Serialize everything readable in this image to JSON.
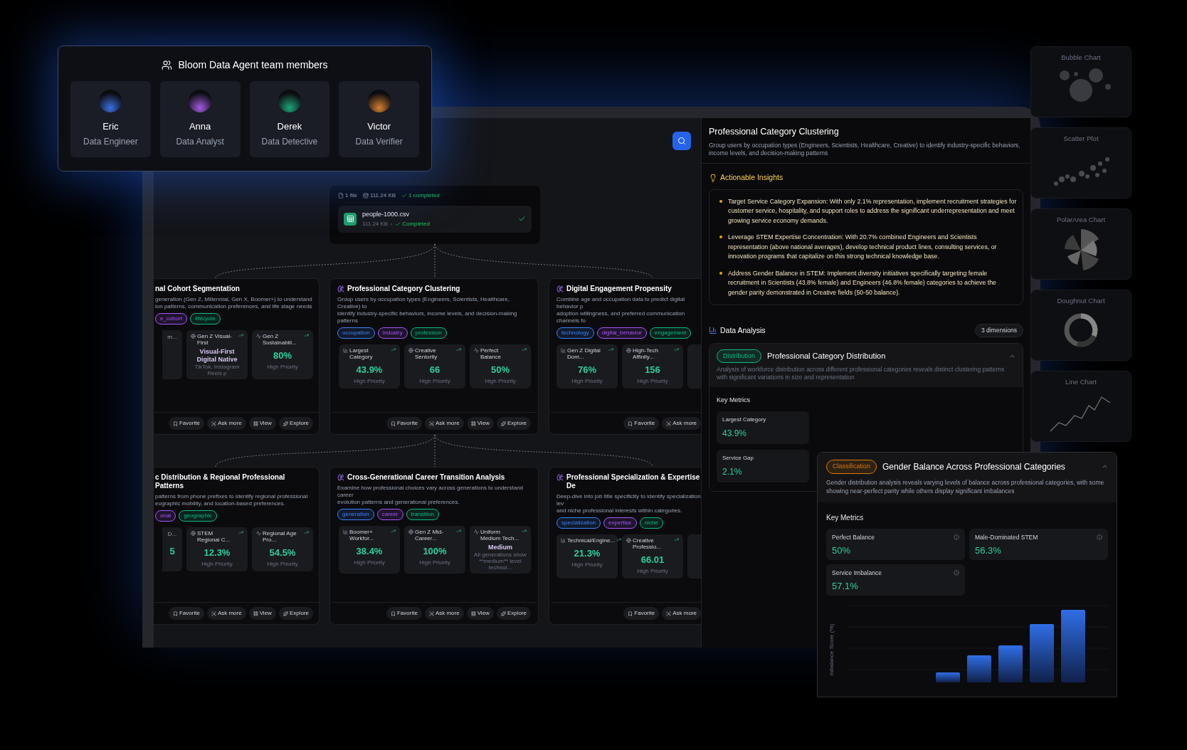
{
  "team_panel": {
    "title": "Bloom Data Agent team members",
    "members": [
      {
        "name": "Eric",
        "role": "Data Engineer",
        "color": "#3b6fe0"
      },
      {
        "name": "Anna",
        "role": "Data Analyst",
        "color": "#a35ce0"
      },
      {
        "name": "Derek",
        "role": "Data Detective",
        "color": "#1fa37a"
      },
      {
        "name": "Victor",
        "role": "Data Verifier",
        "color": "#d4802f"
      }
    ]
  },
  "canvas": {
    "file_node": {
      "file_count": "1 file",
      "total_size": "111.24 KB",
      "status": "1 completed",
      "file_name": "people-1000.csv",
      "file_size": "111.24 KB",
      "file_status": "Completed"
    },
    "cards": [
      {
        "kind": "cut_left",
        "title": "nal Cohort Segmentation",
        "description": [
          "generation (Gen Z, Millennial, Gen X, Boomer+) to understand",
          "ion patterns, communication preferences, and life stage needs"
        ],
        "tags": [
          {
            "label": "e_cohort",
            "color": "#a855f7"
          },
          {
            "label": "lifecycle",
            "color": "#10b981"
          }
        ],
        "metrics": [
          {
            "kind": "partial",
            "label": "m..."
          },
          {
            "kind": "text",
            "label": "Gen Z Visual-First",
            "value": "Visual-First Digital Native",
            "note": "TikTok, Instagram Reels p"
          },
          {
            "kind": "stat",
            "label": "Gen Z Sustainabili...",
            "value": "80%",
            "note": "High Priority"
          }
        ],
        "actions": [
          "Favorite",
          "Ask more",
          "View",
          "Explore"
        ]
      },
      {
        "kind": "full",
        "title": "Professional Category Clustering",
        "description": [
          "Group users by occupation types (Engineers, Scientists, Healthcare, Creative) to",
          "identify industry-specific behaviors, income levels, and decision-making patterns"
        ],
        "tags": [
          {
            "label": "occupation",
            "color": "#3b82f6"
          },
          {
            "label": "industry",
            "color": "#a855f7"
          },
          {
            "label": "profession",
            "color": "#10b981"
          }
        ],
        "metrics": [
          {
            "kind": "stat",
            "label": "Largest Category",
            "value": "43.9%",
            "note": "High Priority"
          },
          {
            "kind": "stat",
            "label": "Creative Seniority",
            "value": "66",
            "note": "High Priority"
          },
          {
            "kind": "stat",
            "label": "Perfect Balance",
            "value": "50%",
            "note": "High Priority"
          }
        ],
        "actions": [
          "Favorite",
          "Ask more",
          "View",
          "Explore"
        ]
      },
      {
        "kind": "cut_right",
        "title": "Digital Engagement Propensity",
        "description": [
          "Combine age and occupation data to predict digital behavior p",
          "adoption willingness, and preferred communication channels fo"
        ],
        "tags": [
          {
            "label": "technology",
            "color": "#3b82f6"
          },
          {
            "label": "digital_behavior",
            "color": "#a855f7"
          },
          {
            "label": "engagement",
            "color": "#10b981"
          }
        ],
        "metrics": [
          {
            "kind": "stat",
            "label": "Gen Z Digital Dom...",
            "value": "76%",
            "note": "High Priority"
          },
          {
            "kind": "stat",
            "label": "High-Tech Affinity...",
            "value": "156",
            "note": "High Priority"
          },
          {
            "kind": "partial"
          }
        ],
        "actions": [
          "Favorite",
          "Ask more"
        ]
      },
      {
        "kind": "cut_left",
        "title": "c Distribution & Regional Professional Patterns",
        "description": [
          "patterns from phone prefixes to identify regional professional",
          "eographic mobility, and location-based preferences."
        ],
        "tags": [
          {
            "label": "onal",
            "color": "#a855f7"
          },
          {
            "label": "geographic",
            "color": "#10b981"
          }
        ],
        "metrics": [
          {
            "kind": "partial",
            "label": "D...",
            "value": "5"
          },
          {
            "kind": "stat",
            "label": "STEM Regional C...",
            "value": "12.3%",
            "note": "High Priority"
          },
          {
            "kind": "stat",
            "label": "Regional Age Pro...",
            "value": "54.5%",
            "note": "High Priority"
          }
        ],
        "actions": [
          "Favorite",
          "Ask more",
          "View",
          "Explore"
        ]
      },
      {
        "kind": "full",
        "title": "Cross-Generational Career Transition Analysis",
        "description": [
          "Examine how professional choices vary across generations to understand career",
          "evolution patterns and generational preferences."
        ],
        "tags": [
          {
            "label": "generation",
            "color": "#3b82f6"
          },
          {
            "label": "career",
            "color": "#a855f7"
          },
          {
            "label": "transition",
            "color": "#10b981"
          }
        ],
        "metrics": [
          {
            "kind": "stat",
            "label": "Boomer+ Workfor...",
            "value": "38.4%",
            "note": "High Priority"
          },
          {
            "kind": "stat",
            "label": "Gen Z Mid-Career...",
            "value": "100%",
            "note": "High Priority"
          },
          {
            "kind": "text",
            "label": "Uniform Medium Tech...",
            "value": "Medium",
            "note": "All generations show **medium** level technol..."
          }
        ],
        "actions": [
          "Favorite",
          "Ask more",
          "View",
          "Explore"
        ]
      },
      {
        "kind": "cut_right",
        "title": "Professional Specialization & Expertise De",
        "description": [
          "Deep-dive into job title specificity to identify specialization lev",
          "and niche professional interests within categories."
        ],
        "tags": [
          {
            "label": "specialization",
            "color": "#3b82f6"
          },
          {
            "label": "expertise",
            "color": "#a855f7"
          },
          {
            "label": "niche",
            "color": "#10b981"
          }
        ],
        "metrics": [
          {
            "kind": "stat",
            "label": "Technical/Engine...",
            "value": "21.3%",
            "note": "High Priority"
          },
          {
            "kind": "stat",
            "label": "Creative Professio...",
            "value": "66.01",
            "note": "High Priority"
          },
          {
            "kind": "partial"
          }
        ],
        "actions": [
          "Favorite",
          "Ask more"
        ]
      }
    ]
  },
  "detail_panel": {
    "title": "Professional Category Clustering",
    "description": "Group users by occupation types (Engineers, Scientists, Healthcare, Creative) to identify industry-specific behaviors, income levels, and decision-making patterns",
    "insights": {
      "heading": "Actionable Insights",
      "items": [
        "Target Service Category Expansion: With only 2.1% representation, implement recruitment strategies for customer service, hospitality, and support roles to address the significant underrepresentation and meet growing service economy demands.",
        "Leverage STEM Expertise Concentration: With 20.7% combined Engineers and Scientists representation (above national averages), develop technical product lines, consulting services, or innovation programs that capitalize on this strong technical knowledge base.",
        "Address Gender Balance in STEM: Implement diversity initiatives specifically targeting female recruitment in Scientists (43.8% female) and Engineers (46.8% female) categories to achieve the gender parity demonstrated in Creative fields (50-50 balance)."
      ]
    },
    "analysis": {
      "heading": "Data Analysis",
      "badge": "3 dimensions",
      "section": {
        "tag": {
          "label": "Distribution",
          "color": "#10b981"
        },
        "title": "Professional Category Distribution",
        "expanded": true,
        "description": "Analysis of workforce distribution across different professional categories reveals distinct clustering patterns with significant variations in size and representation",
        "metrics_heading": "Key Metrics",
        "metrics": [
          {
            "label": "Largest Category",
            "value": "43.9%"
          },
          {
            "label": "Service Gap",
            "value": "2.1%"
          }
        ]
      }
    }
  },
  "gender_card": {
    "tag": {
      "label": "Classification",
      "color": "#d97706"
    },
    "title": "Gender Balance Across Professional Categories",
    "expanded": true,
    "description": "Gender distribution analysis reveals varying levels of balance across professional categories, with some showing near-perfect parity while others display significant imbalances",
    "metrics_heading": "Key Metrics",
    "metrics": [
      {
        "label": "Perfect Balance",
        "value": "50%"
      },
      {
        "label": "Male-Dominated STEM",
        "value": "56.3%"
      },
      {
        "label": "Service Imbalance",
        "value": "57.1%"
      }
    ],
    "chart_ylabel": "mbalance Score (%)"
  },
  "chart_gallery": [
    {
      "kind": "bubble",
      "label": "Bubble Chart"
    },
    {
      "kind": "scatter",
      "label": "Scatter Plot"
    },
    {
      "kind": "polar",
      "label": "PolarArea Chart"
    },
    {
      "kind": "doughnut",
      "label": "Doughnut Chart"
    },
    {
      "kind": "line",
      "label": "Line Chart"
    }
  ]
}
